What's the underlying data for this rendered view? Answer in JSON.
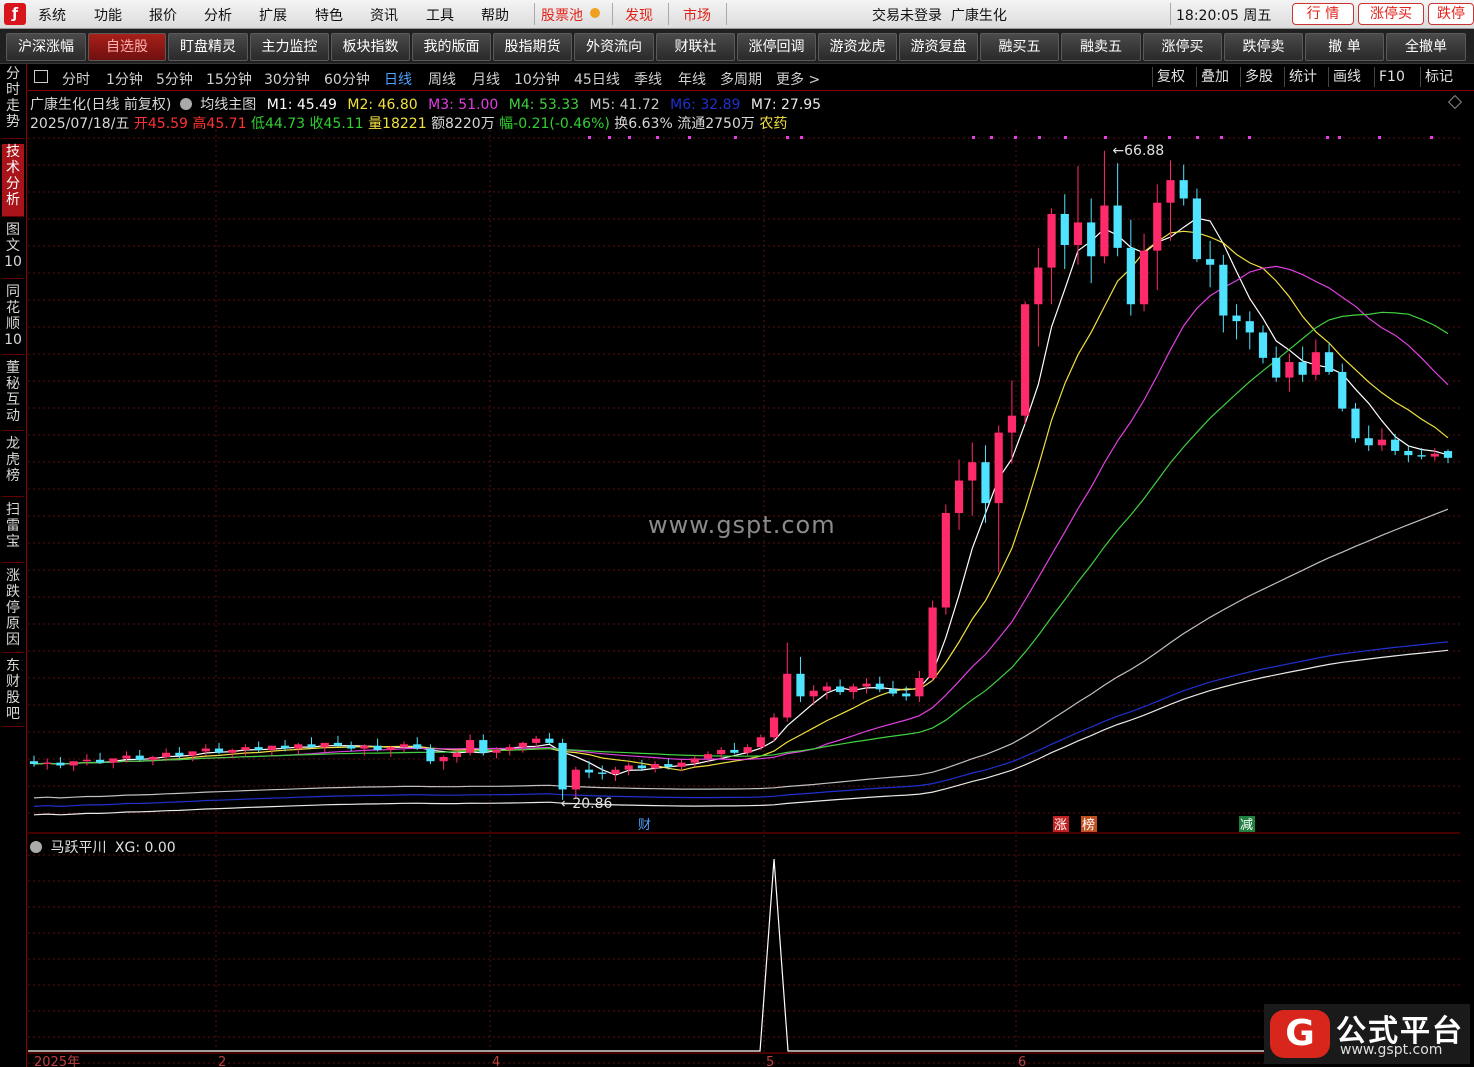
{
  "menubar": {
    "items": [
      "系统",
      "功能",
      "报价",
      "分析",
      "扩展",
      "特色",
      "资讯",
      "工具",
      "帮助"
    ],
    "stock_pool": "股票池",
    "discover": "发现",
    "market": "市场",
    "login_status": "交易未登录",
    "stock_name": "广康生化",
    "clock": "18:20:05 周五",
    "right_buttons": [
      "行 情",
      "涨停买",
      "跌停"
    ]
  },
  "toolbar": [
    "沪深涨幅",
    "自选股",
    "盯盘精灵",
    "主力监控",
    "板块指数",
    "我的版面",
    "股指期货",
    "外资流向",
    "财联社",
    "涨停回调",
    "游资龙虎",
    "游资复盘",
    "融买五",
    "融卖五",
    "涨停买",
    "跌停卖",
    "撤 单",
    "全撤单"
  ],
  "left_tabs": [
    "分时走势",
    "技术分析",
    "图文10",
    "同花顺10",
    "董秘互动",
    "龙虎榜",
    "扫雷宝",
    "涨跌停原因",
    "东财股吧"
  ],
  "periods": [
    "分时",
    "1分钟",
    "5分钟",
    "15分钟",
    "30分钟",
    "60分钟",
    "日线",
    "周线",
    "月线",
    "10分钟",
    "45日线",
    "季线",
    "年线",
    "多周期",
    "更多 >"
  ],
  "right_tools": [
    "复权",
    "叠加",
    "多股",
    "统计",
    "画线",
    "F10",
    "标记"
  ],
  "ma_row": {
    "title": "广康生化(日线 前复权)",
    "main": "均线主图",
    "m1": "M1: 45.49",
    "m2": "M2: 46.80",
    "m3": "M3: 51.00",
    "m4": "M4: 53.33",
    "m5": "M5: 41.72",
    "m6": "M6: 32.89",
    "m7": "M7: 27.95"
  },
  "quote_row": {
    "date": "2025/07/18/五",
    "open": "开45.59",
    "high": "高45.71",
    "low": "低44.73",
    "close": "收45.11",
    "volume": "量18221",
    "amount": "额8220万",
    "change": "幅-0.21(-0.46%)",
    "turnover": "换6.63%",
    "float": "流通2750万",
    "sector": "农药"
  },
  "chart_labels": {
    "high_price": "66.88",
    "low_price": "20.86",
    "tag_cai": "财",
    "tag_zhang": "涨",
    "tag_bang": "榜",
    "tag_jian": "减",
    "watermark": "www.gspt.com"
  },
  "indicator": {
    "name": "马跃平川",
    "value": "XG: 0.00"
  },
  "x_axis": [
    "2025年",
    "2",
    "4",
    "5",
    "6"
  ],
  "brand": {
    "name": "公式平台",
    "url": "www.gspt.com",
    "mark": "G"
  },
  "colors": {
    "up": "#ff2a6a",
    "down": "#4fe3ff",
    "ma_white": "#ffffff",
    "ma_yellow": "#f0e040",
    "ma_magenta": "#e040e0",
    "ma_green": "#40d040",
    "ma_gray": "#c0c0c0",
    "ma_blue": "#2030d0"
  },
  "chart_data": {
    "type": "candlestick",
    "price_range": [
      20,
      68
    ],
    "candles": [
      [
        23.6,
        24.0,
        23.2,
        23.4
      ],
      [
        23.4,
        23.8,
        23.0,
        23.5
      ],
      [
        23.5,
        23.9,
        23.1,
        23.3
      ],
      [
        23.3,
        23.6,
        22.9,
        23.6
      ],
      [
        23.6,
        24.1,
        23.3,
        23.7
      ],
      [
        23.7,
        24.2,
        23.4,
        23.5
      ],
      [
        23.5,
        23.8,
        23.1,
        23.8
      ],
      [
        23.8,
        24.3,
        23.5,
        24.0
      ],
      [
        24.0,
        24.4,
        23.6,
        23.7
      ],
      [
        23.7,
        24.0,
        23.3,
        23.9
      ],
      [
        23.9,
        24.5,
        23.6,
        24.2
      ],
      [
        24.2,
        24.6,
        23.8,
        24.0
      ],
      [
        24.0,
        24.3,
        23.6,
        24.3
      ],
      [
        24.3,
        24.8,
        24.0,
        24.5
      ],
      [
        24.5,
        24.9,
        24.1,
        24.2
      ],
      [
        24.2,
        24.5,
        23.8,
        24.4
      ],
      [
        24.4,
        24.8,
        24.0,
        24.6
      ],
      [
        24.6,
        25.0,
        24.2,
        24.4
      ],
      [
        24.4,
        24.7,
        24.0,
        24.7
      ],
      [
        24.7,
        25.1,
        24.3,
        24.5
      ],
      [
        24.5,
        24.9,
        24.1,
        24.8
      ],
      [
        24.8,
        25.3,
        24.5,
        24.6
      ],
      [
        24.6,
        24.9,
        24.2,
        24.9
      ],
      [
        24.9,
        25.4,
        24.6,
        24.7
      ],
      [
        24.7,
        25.0,
        24.3,
        24.5
      ],
      [
        24.5,
        24.8,
        24.0,
        24.7
      ],
      [
        24.7,
        25.2,
        24.3,
        24.4
      ],
      [
        24.4,
        24.7,
        23.9,
        24.6
      ],
      [
        24.6,
        25.0,
        24.2,
        24.8
      ],
      [
        24.8,
        25.3,
        24.4,
        24.5
      ],
      [
        24.5,
        24.8,
        23.4,
        23.6
      ],
      [
        23.6,
        24.0,
        23.0,
        23.9
      ],
      [
        23.9,
        24.4,
        23.5,
        24.2
      ],
      [
        24.2,
        25.5,
        24.0,
        25.1
      ],
      [
        25.1,
        25.5,
        24.0,
        24.2
      ],
      [
        24.2,
        24.6,
        23.8,
        24.4
      ],
      [
        24.4,
        24.8,
        24.0,
        24.6
      ],
      [
        24.6,
        25.0,
        24.2,
        24.9
      ],
      [
        24.9,
        25.4,
        24.5,
        25.2
      ],
      [
        25.2,
        25.6,
        24.8,
        24.9
      ],
      [
        24.9,
        25.2,
        20.86,
        21.6
      ],
      [
        21.6,
        23.2,
        21.0,
        23.0
      ],
      [
        23.0,
        23.6,
        22.4,
        22.8
      ],
      [
        22.8,
        23.3,
        22.3,
        22.7
      ],
      [
        22.7,
        23.2,
        22.2,
        23.0
      ],
      [
        23.0,
        23.5,
        22.6,
        23.3
      ],
      [
        23.3,
        23.7,
        22.9,
        23.1
      ],
      [
        23.1,
        23.6,
        22.8,
        23.4
      ],
      [
        23.4,
        23.8,
        23.0,
        23.2
      ],
      [
        23.2,
        23.7,
        22.9,
        23.5
      ],
      [
        23.5,
        24.0,
        23.2,
        23.8
      ],
      [
        23.8,
        24.3,
        23.5,
        24.1
      ],
      [
        24.1,
        24.6,
        23.8,
        24.4
      ],
      [
        24.4,
        24.9,
        24.1,
        24.2
      ],
      [
        24.2,
        24.8,
        24.0,
        24.6
      ],
      [
        24.6,
        25.5,
        24.4,
        25.3
      ],
      [
        25.3,
        27.0,
        25.0,
        26.7
      ],
      [
        26.7,
        32.0,
        26.4,
        29.8
      ],
      [
        29.8,
        31.0,
        27.8,
        28.2
      ],
      [
        28.2,
        29.0,
        27.6,
        28.6
      ],
      [
        28.6,
        29.2,
        28.0,
        28.9
      ],
      [
        28.9,
        29.4,
        28.3,
        28.5
      ],
      [
        28.5,
        29.1,
        28.0,
        28.9
      ],
      [
        28.9,
        29.5,
        28.4,
        29.1
      ],
      [
        29.1,
        29.6,
        28.5,
        28.7
      ],
      [
        28.7,
        29.3,
        28.2,
        28.4
      ],
      [
        28.4,
        28.9,
        27.9,
        28.2
      ],
      [
        28.2,
        30.0,
        27.8,
        29.5
      ],
      [
        29.5,
        35.0,
        29.3,
        34.5
      ],
      [
        34.5,
        41.8,
        34.0,
        41.2
      ],
      [
        41.2,
        45.0,
        40.0,
        43.5
      ],
      [
        43.5,
        46.2,
        41.0,
        44.8
      ],
      [
        44.8,
        46.0,
        40.5,
        41.9
      ],
      [
        41.9,
        47.4,
        37.0,
        46.9
      ],
      [
        46.9,
        50.6,
        44.7,
        48.1
      ],
      [
        48.1,
        56.2,
        47.5,
        56.0
      ],
      [
        56.0,
        60.0,
        53.0,
        58.6
      ],
      [
        58.6,
        62.8,
        56.0,
        62.4
      ],
      [
        62.4,
        63.8,
        58.5,
        60.2
      ],
      [
        60.2,
        65.8,
        58.8,
        61.8
      ],
      [
        61.8,
        63.5,
        57.5,
        59.4
      ],
      [
        59.4,
        66.88,
        58.9,
        63.0
      ],
      [
        63.0,
        66.0,
        59.4,
        60.0
      ],
      [
        60.0,
        62.0,
        55.2,
        56.0
      ],
      [
        56.0,
        61.0,
        55.5,
        59.8
      ],
      [
        59.8,
        64.5,
        57.0,
        63.2
      ],
      [
        63.2,
        66.2,
        60.5,
        64.8
      ],
      [
        64.8,
        65.9,
        63.0,
        63.5
      ],
      [
        63.5,
        64.2,
        59.0,
        59.2
      ],
      [
        59.2,
        60.5,
        57.2,
        58.8
      ],
      [
        58.8,
        59.5,
        54.0,
        55.2
      ],
      [
        55.2,
        56.0,
        53.5,
        54.8
      ],
      [
        54.8,
        55.5,
        52.8,
        54.0
      ],
      [
        54.0,
        54.5,
        51.8,
        52.2
      ],
      [
        52.2,
        53.0,
        50.5,
        50.8
      ],
      [
        50.8,
        52.5,
        49.8,
        51.9
      ],
      [
        51.9,
        53.0,
        50.5,
        51.0
      ],
      [
        51.0,
        53.5,
        50.6,
        52.6
      ],
      [
        52.6,
        53.2,
        51.0,
        51.2
      ],
      [
        51.2,
        51.8,
        48.4,
        48.6
      ],
      [
        48.6,
        49.0,
        46.2,
        46.5
      ],
      [
        46.5,
        47.4,
        45.6,
        46.0
      ],
      [
        46.0,
        47.2,
        45.6,
        46.4
      ],
      [
        46.4,
        46.8,
        45.3,
        45.6
      ],
      [
        45.6,
        45.9,
        44.8,
        45.3
      ],
      [
        45.3,
        45.8,
        45.0,
        45.2
      ],
      [
        45.2,
        45.8,
        44.9,
        45.4
      ],
      [
        45.59,
        45.71,
        44.73,
        45.11
      ]
    ],
    "ma_last": {
      "M1": 45.49,
      "M2": 46.8,
      "M3": 51.0,
      "M4": 53.33,
      "M5": 41.72,
      "M6": 32.89,
      "M7": 27.95
    },
    "indicator_signal_index": 56
  }
}
